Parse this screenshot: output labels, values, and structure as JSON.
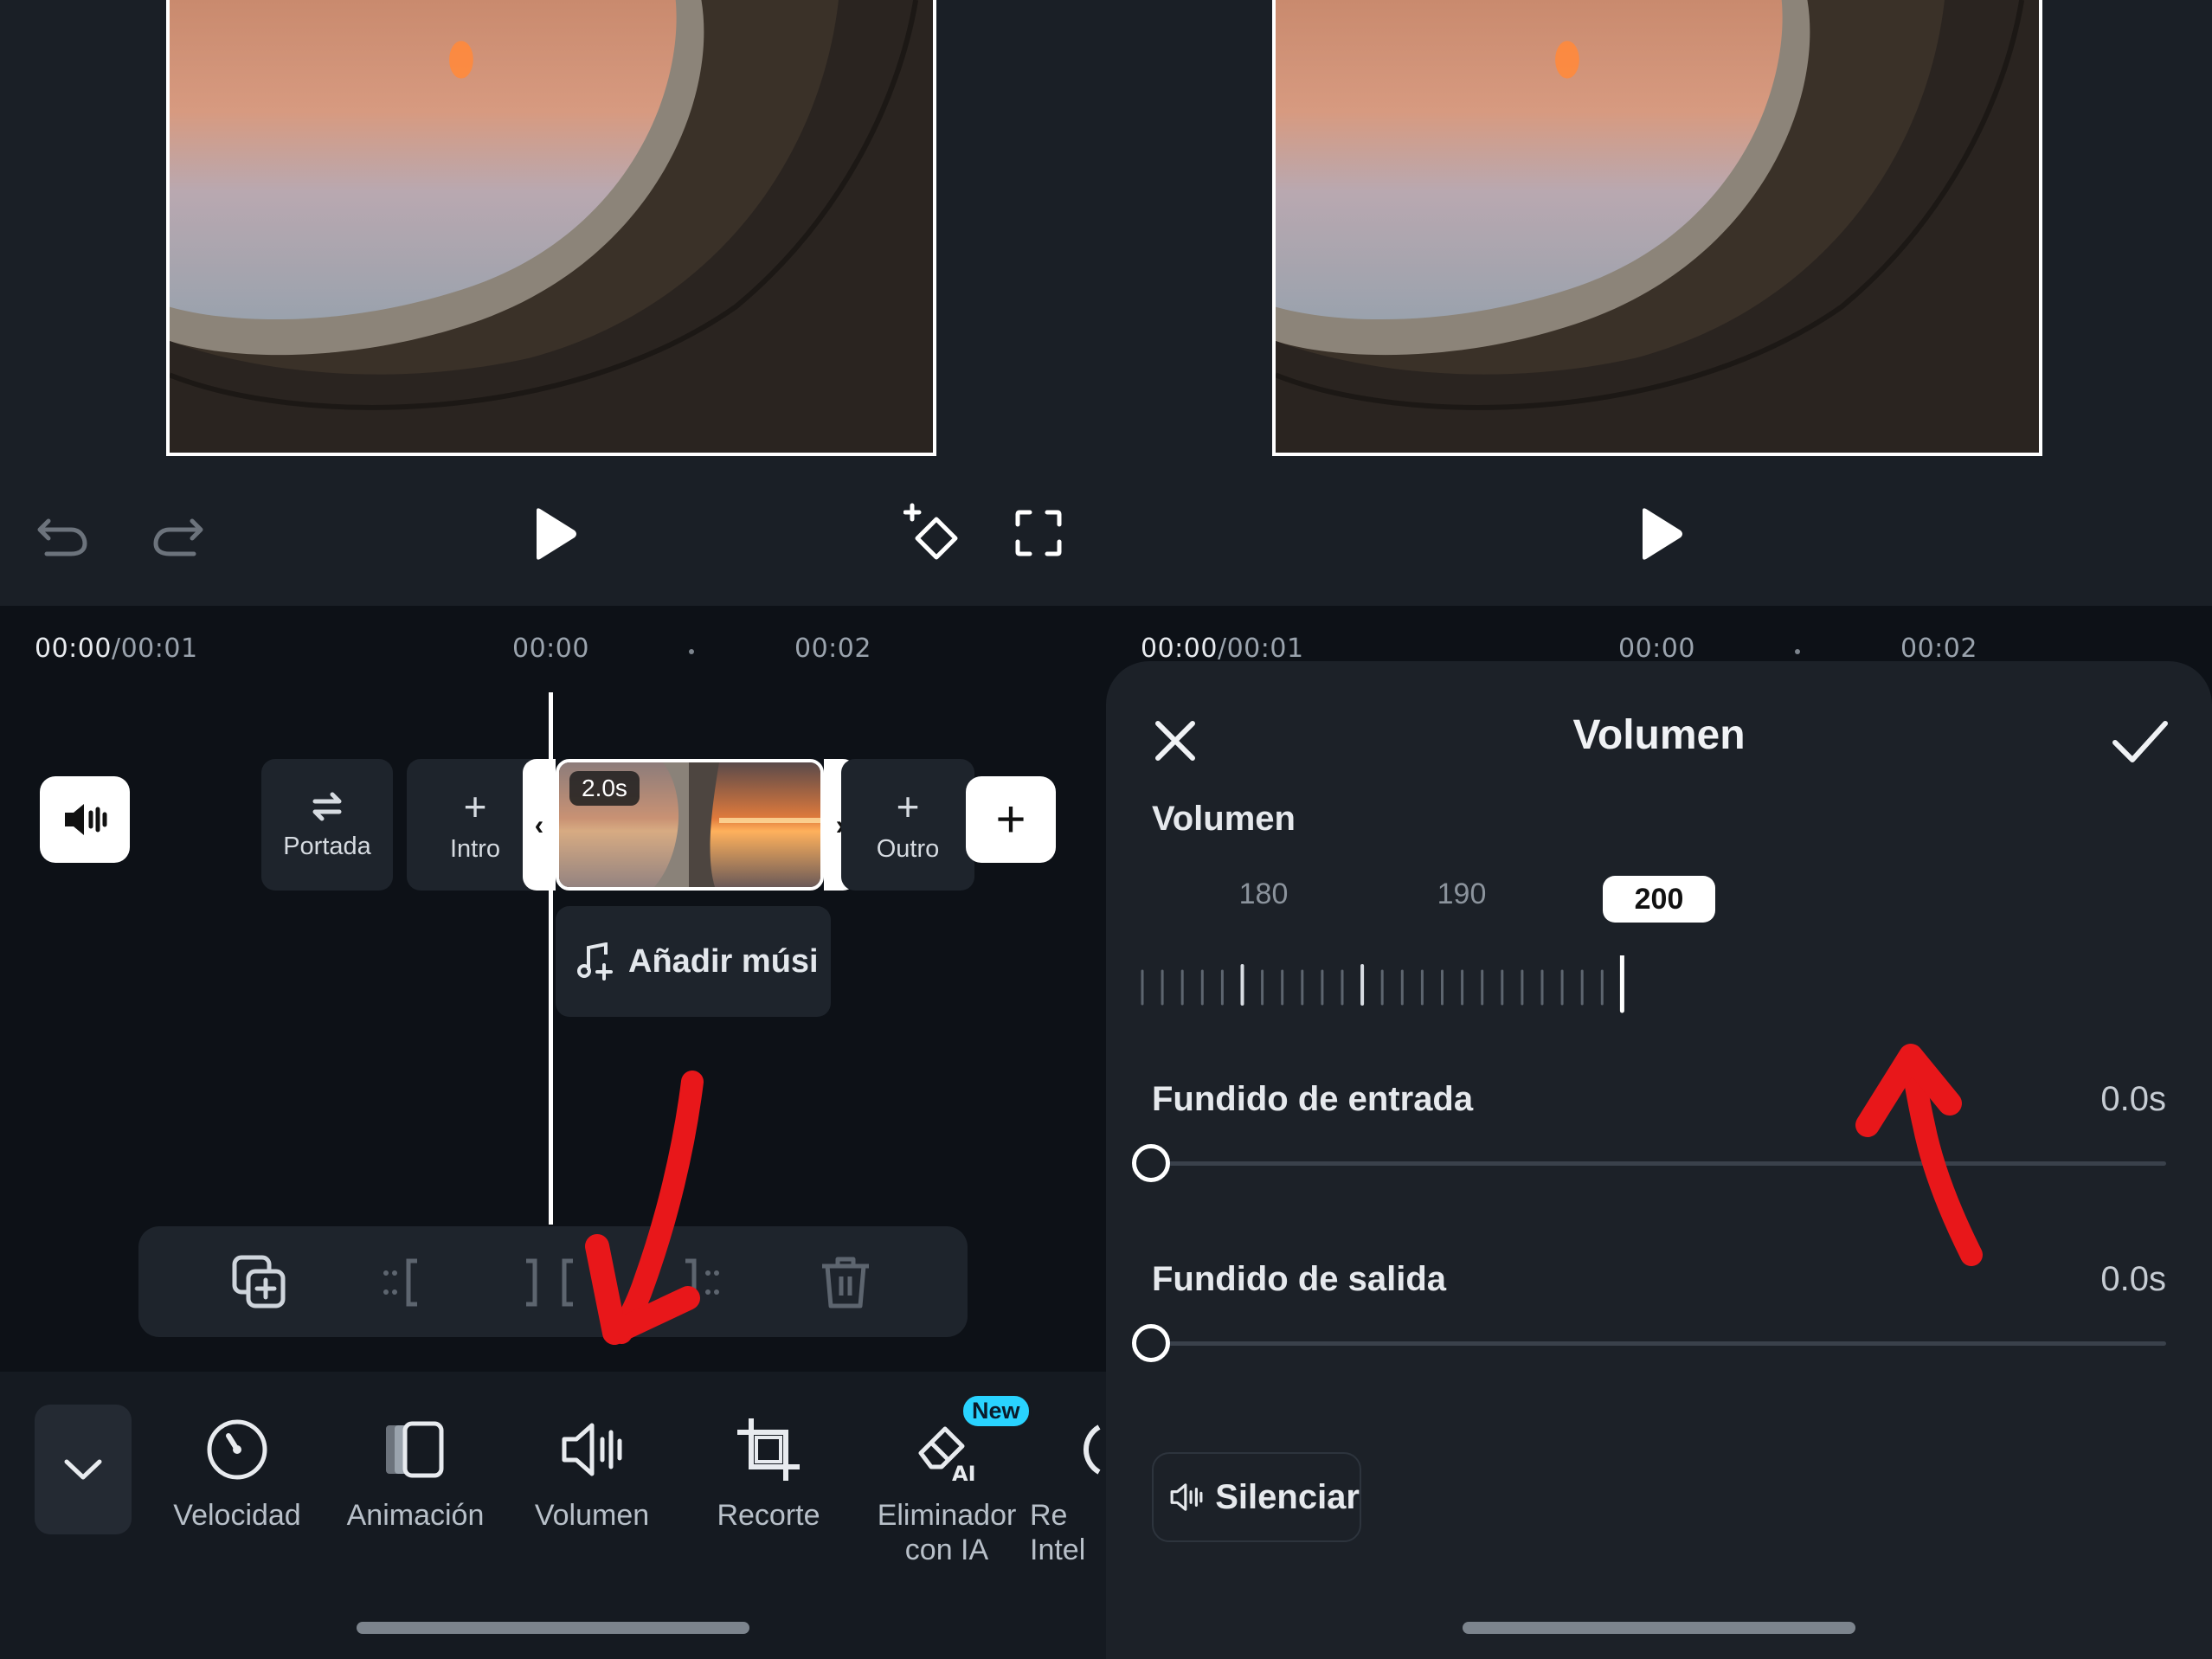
{
  "left": {
    "timeline": {
      "current_time": "00:00",
      "total_time": "/00:01",
      "ruler_label_a": "00:00",
      "ruler_label_b": "00:02",
      "clip_duration": "2.0s",
      "cover_label": "Portada",
      "intro_label": "Intro",
      "outro_label": "Outro",
      "add_music_label": "Añadir músi"
    },
    "toolbar": {
      "items": [
        {
          "label": "Velocidad",
          "icon": "speed-icon"
        },
        {
          "label": "Animación",
          "icon": "animation-icon"
        },
        {
          "label": "Volumen",
          "icon": "volume-icon"
        },
        {
          "label": "Recorte",
          "icon": "crop-icon"
        },
        {
          "label": "Eliminador\ncon IA",
          "icon": "ai-eraser-icon"
        },
        {
          "label": "Re\nIntel",
          "icon": "partial-icon"
        }
      ],
      "new_badge": "New"
    }
  },
  "right": {
    "timeline": {
      "current_time": "00:00",
      "total_time": "/00:01",
      "ruler_label_a": "00:00",
      "ruler_label_b": "00:02"
    },
    "volume_panel": {
      "title": "Volumen",
      "section_label": "Volumen",
      "scale_labels": [
        "180",
        "190"
      ],
      "selected_value": "200",
      "fade_in_label": "Fundido de entrada",
      "fade_in_value": "0.0s",
      "fade_out_label": "Fundido de salida",
      "fade_out_value": "0.0s",
      "mute_label": "Silenciar"
    }
  },
  "colors": {
    "annotation_arrow": "#e8171a",
    "new_badge": "#29d3ff",
    "panel_bg": "#1c2128",
    "timeline_bg": "#0d1117"
  }
}
